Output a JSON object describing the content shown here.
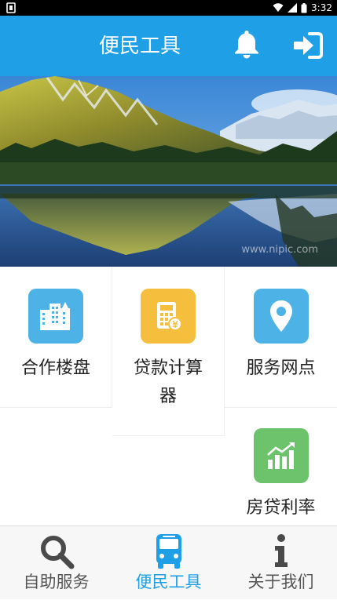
{
  "status_bar": {
    "time": "3:32",
    "icons": [
      "notification-icon",
      "wifi-icon",
      "signal-icon",
      "battery-icon"
    ]
  },
  "header": {
    "title": "便民工具",
    "icons": [
      "bell-icon",
      "login-icon"
    ]
  },
  "banner": {
    "image": "mountain-lake-landscape",
    "watermark": "www.nipic.com"
  },
  "tools": [
    {
      "label": "合作楼盘",
      "icon": "buildings-icon",
      "color": "#4db3e6"
    },
    {
      "label": "贷款计算器",
      "icon": "calculator-icon",
      "color": "#f5be3d"
    },
    {
      "label": "服务网点",
      "icon": "location-pin-icon",
      "color": "#4db3e6"
    },
    {
      "label": "房贷利率",
      "icon": "bar-chart-icon",
      "color": "#6cc36c"
    }
  ],
  "tabbar": {
    "items": [
      {
        "label": "自助服务",
        "icon": "search-icon",
        "active": false
      },
      {
        "label": "便民工具",
        "icon": "bus-icon",
        "active": true
      },
      {
        "label": "关于我们",
        "icon": "info-icon",
        "active": false
      }
    ],
    "active_color": "#1fa0e6",
    "inactive_color": "#555555"
  },
  "colors": {
    "header_bg": "#1fa0e6",
    "status_bar_bg": "#000000"
  }
}
